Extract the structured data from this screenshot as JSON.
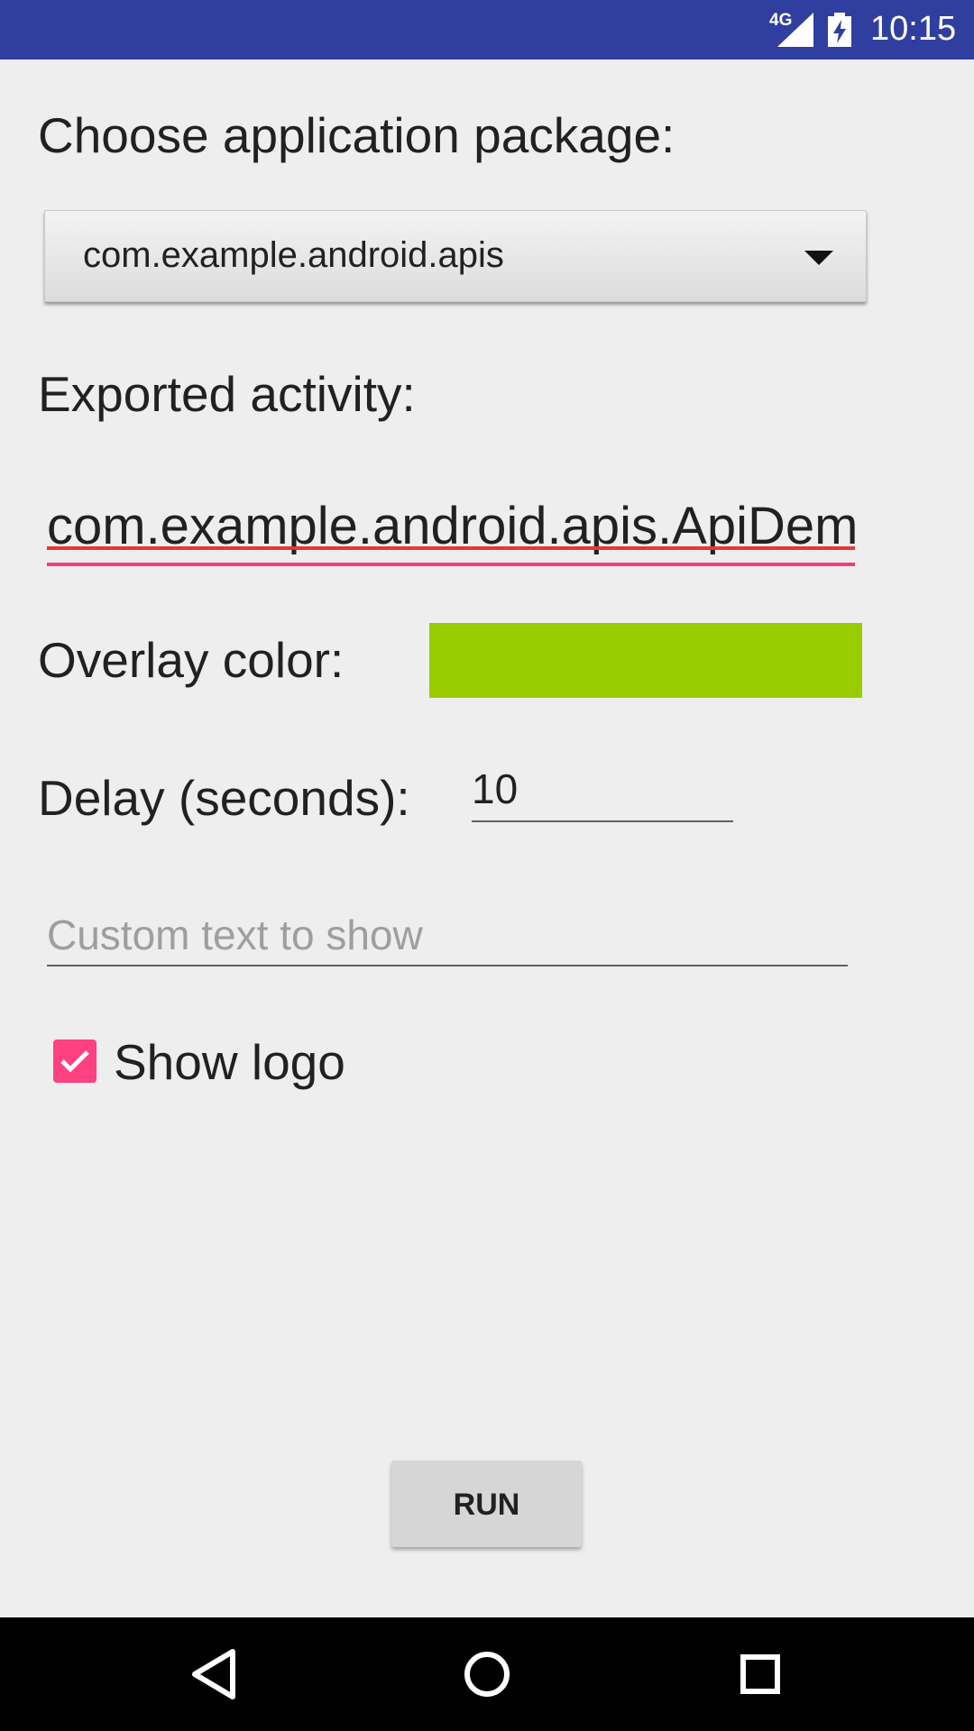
{
  "status_bar": {
    "network": "4G",
    "time": "10:15",
    "signal_icon": "cell-signal-icon",
    "battery_icon": "battery-charging-icon",
    "background_color": "#303f9f"
  },
  "form": {
    "package_label": "Choose application package:",
    "package_value": "com.example.android.apis",
    "activity_label": "Exported activity:",
    "activity_value": "com.example.android.apis.ApiDem",
    "overlay_label": "Overlay color:",
    "overlay_color": "#99cc00",
    "delay_label": "Delay (seconds):",
    "delay_value": "10",
    "custom_text_placeholder": "Custom text to show",
    "show_logo_label": "Show logo",
    "show_logo_checked": true,
    "run_label": "RUN"
  },
  "nav_bar": {
    "back_icon": "back-triangle-icon",
    "home_icon": "home-circle-icon",
    "recents_icon": "recents-square-icon"
  },
  "colors": {
    "accent": "#ff4081",
    "primary_dark": "#303f9f",
    "background": "#eeeeee"
  }
}
